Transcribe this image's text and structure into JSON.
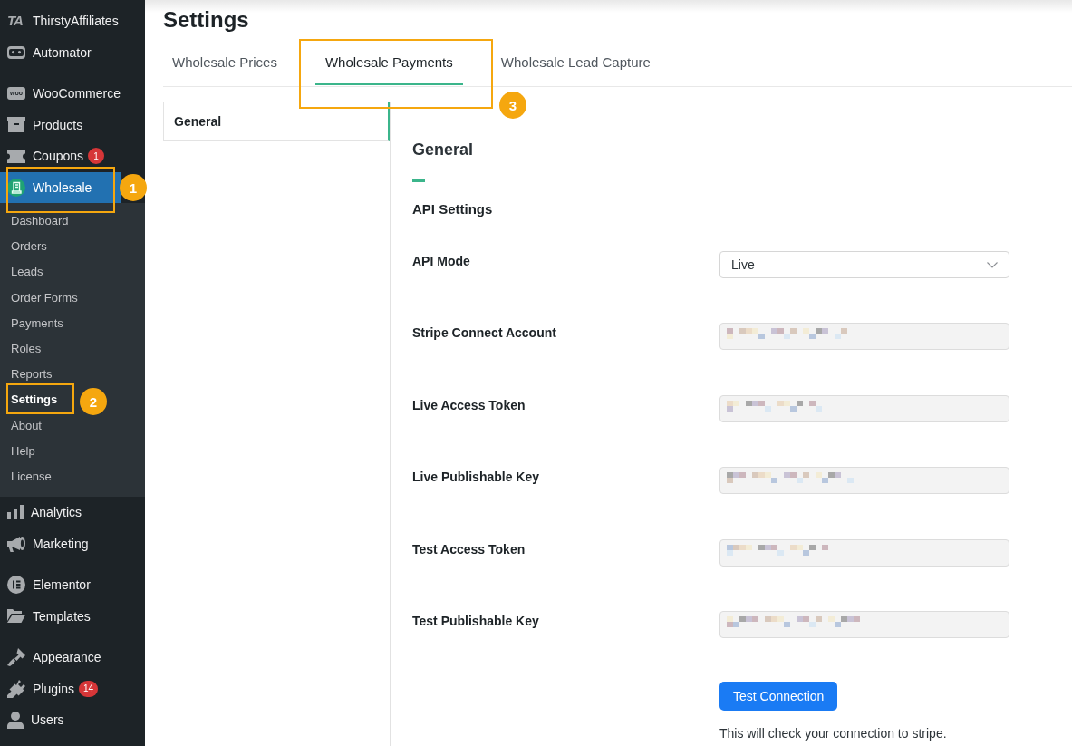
{
  "sidebar": {
    "groups": [
      [
        {
          "label": "ThirstyAffiliates",
          "logo": "TA",
          "selected": false
        },
        {
          "label": "Automator",
          "selected": false
        }
      ],
      [
        {
          "label": "WooCommerce",
          "logo": "woo",
          "selected": false
        },
        {
          "label": "Products",
          "selected": false
        },
        {
          "label": "Coupons",
          "badge": "1",
          "selected": false
        },
        {
          "label": "Wholesale",
          "selected": true,
          "children": [
            {
              "label": "Dashboard",
              "selected": false
            },
            {
              "label": "Orders",
              "selected": false
            },
            {
              "label": "Leads",
              "selected": false
            },
            {
              "label": "Order Forms",
              "selected": false
            },
            {
              "label": "Payments",
              "selected": false
            },
            {
              "label": "Roles",
              "selected": false
            },
            {
              "label": "Reports",
              "selected": false
            },
            {
              "label": "Settings",
              "selected": true
            },
            {
              "label": "About",
              "selected": false
            },
            {
              "label": "Help",
              "selected": false
            },
            {
              "label": "License",
              "selected": false
            }
          ]
        },
        {
          "label": "Analytics",
          "selected": false
        },
        {
          "label": "Marketing",
          "selected": false
        }
      ],
      [
        {
          "label": "Elementor",
          "selected": false
        },
        {
          "label": "Templates",
          "selected": false
        }
      ],
      [
        {
          "label": "Appearance",
          "selected": false
        },
        {
          "label": "Plugins",
          "badge": "14",
          "selected": false
        },
        {
          "label": "Users",
          "selected": false
        }
      ]
    ]
  },
  "page_title": "Settings",
  "tabs": [
    {
      "label": "Wholesale Prices",
      "selected": false
    },
    {
      "label": "Wholesale Payments",
      "selected": true
    },
    {
      "label": "Wholesale Lead Capture",
      "selected": false
    }
  ],
  "section_nav": [
    {
      "label": "General",
      "selected": true
    }
  ],
  "section": {
    "title": "General",
    "subtitle": "API Settings",
    "fields": [
      {
        "label": "API Mode",
        "kind": "select",
        "value": "Live",
        "disabled": false,
        "blurred": false
      },
      {
        "label": "Stripe Connect Account",
        "kind": "text",
        "disabled": true,
        "blurred": true
      },
      {
        "label": "Live Access Token",
        "kind": "text",
        "disabled": true,
        "blurred": true
      },
      {
        "label": "Live Publishable Key",
        "kind": "text",
        "disabled": true,
        "blurred": true
      },
      {
        "label": "Test Access Token",
        "kind": "text",
        "disabled": true,
        "blurred": true
      },
      {
        "label": "Test Publishable Key",
        "kind": "text",
        "disabled": true,
        "blurred": true
      }
    ],
    "button": "Test Connection",
    "help_text": "This will check your connection to stripe."
  },
  "annotations": [
    {
      "number": "1"
    },
    {
      "number": "2"
    },
    {
      "number": "3"
    }
  ]
}
